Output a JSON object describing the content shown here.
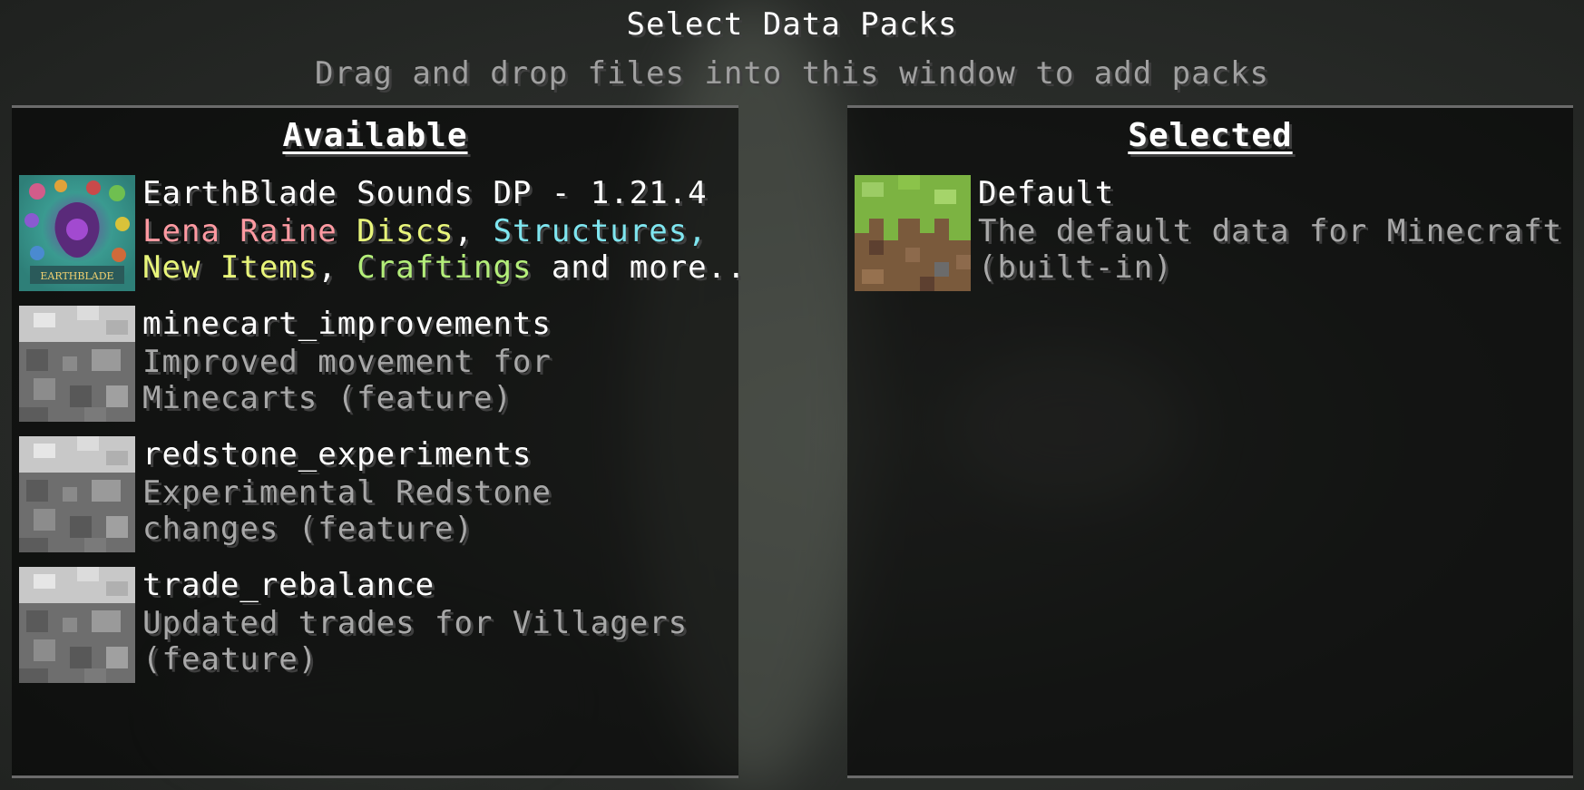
{
  "screen": {
    "title": "Select Data Packs",
    "subtitle": "Drag and drop files into this window to add packs"
  },
  "available": {
    "heading": "Available",
    "packs": [
      {
        "name": "EarthBlade Sounds DP - 1.21.4",
        "icon": "earthblade-pack-icon",
        "desc_line1": [
          {
            "text": "Lena Raine ",
            "color": "pink"
          },
          {
            "text": "Discs",
            "color": "yellow"
          },
          {
            "text": ", ",
            "color": "white"
          },
          {
            "text": "Structures,",
            "color": "cyan"
          }
        ],
        "desc_line2": [
          {
            "text": "New Items",
            "color": "yellow"
          },
          {
            "text": ", ",
            "color": "white"
          },
          {
            "text": "Craftings",
            "color": "green"
          },
          {
            "text": " and more..",
            "color": "white"
          }
        ],
        "icon_text": "EARTHBLADE"
      },
      {
        "name": "minecart_improvements",
        "icon": "stone-pack-icon",
        "desc_line1": "Improved movement for",
        "desc_line2": "Minecarts (feature)"
      },
      {
        "name": "redstone_experiments",
        "icon": "stone-pack-icon",
        "desc_line1": "Experimental Redstone",
        "desc_line2": "changes (feature)"
      },
      {
        "name": "trade_rebalance",
        "icon": "stone-pack-icon",
        "desc_line1": "Updated trades for Villagers",
        "desc_line2": "(feature)"
      }
    ]
  },
  "selected": {
    "heading": "Selected",
    "packs": [
      {
        "name": "Default",
        "icon": "grass-block-icon",
        "desc_line1": "The default data for Minecraft",
        "desc_line2": "(built-in)"
      }
    ]
  },
  "colors": {
    "pink": "#ff9aa2",
    "yellow": "#e8f57a",
    "cyan": "#7fe6f0",
    "green": "#b4ee7a",
    "white": "#ffffff",
    "description_gray": "#a8a8a8"
  }
}
